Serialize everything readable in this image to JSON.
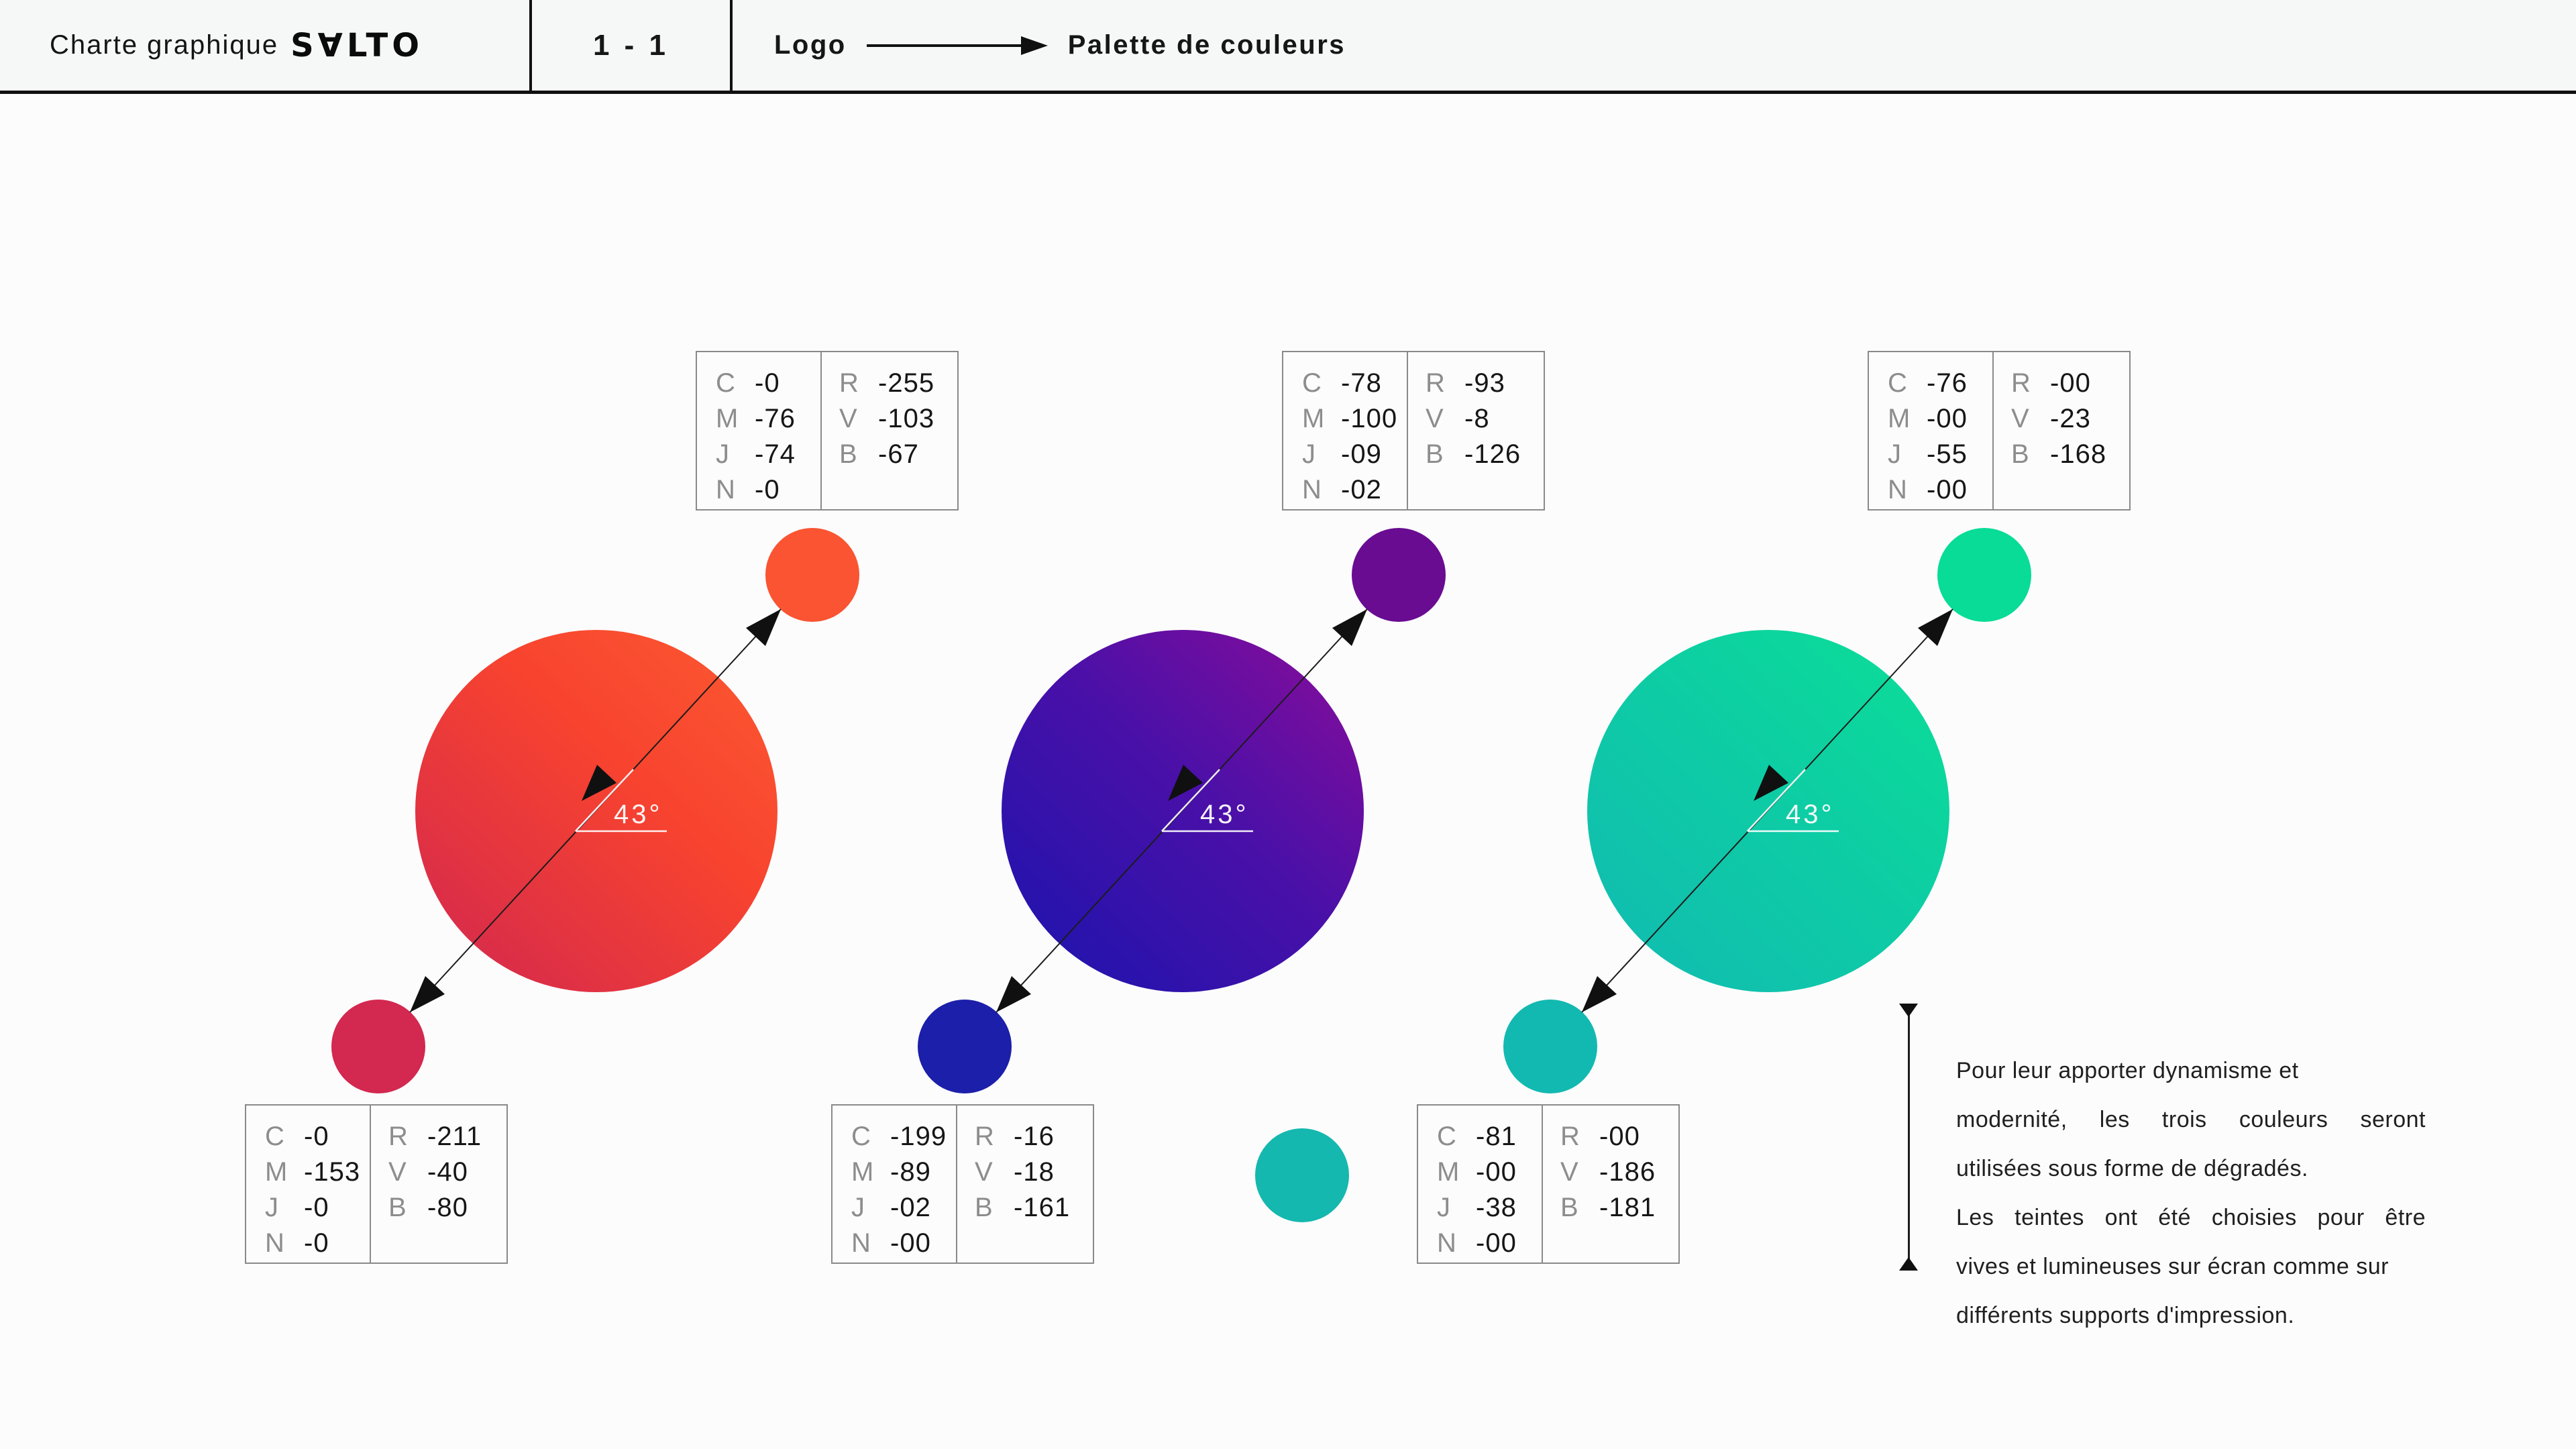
{
  "header": {
    "title_prefix": "Charte graphique",
    "brand": "S∀LTO",
    "page": "1 - 1",
    "section": "Logo",
    "subsection": "Palette de couleurs"
  },
  "angle_label": "43°",
  "groups": [
    {
      "name": "rouge-orange",
      "approx_hex": {
        "gradient_start": "#D12750",
        "gradient_end": "#FB5A31",
        "top_circle": "#FA5432",
        "bottom_circle": "#D32850"
      },
      "top": {
        "cmjn": [
          {
            "k": "C",
            "v": "-0"
          },
          {
            "k": "M",
            "v": "-76"
          },
          {
            "k": "J",
            "v": "-74"
          },
          {
            "k": "N",
            "v": "-0"
          }
        ],
        "rvb": [
          {
            "k": "R",
            "v": "-255"
          },
          {
            "k": "V",
            "v": "-103"
          },
          {
            "k": "B",
            "v": "-67"
          }
        ]
      },
      "bottom": {
        "cmjn": [
          {
            "k": "C",
            "v": "-0"
          },
          {
            "k": "M",
            "v": "-153"
          },
          {
            "k": "J",
            "v": "-0"
          },
          {
            "k": "N",
            "v": "-0"
          }
        ],
        "rvb": [
          {
            "k": "R",
            "v": "-211"
          },
          {
            "k": "V",
            "v": "-40"
          },
          {
            "k": "B",
            "v": "-80"
          }
        ]
      }
    },
    {
      "name": "bleu-violet",
      "approx_hex": {
        "gradient_start": "#1A14AE",
        "gradient_end": "#8C0C99",
        "top_circle": "#690C92",
        "bottom_circle": "#1B1FA9"
      },
      "top": {
        "cmjn": [
          {
            "k": "C",
            "v": "-78"
          },
          {
            "k": "M",
            "v": "-100"
          },
          {
            "k": "J",
            "v": "-09"
          },
          {
            "k": "N",
            "v": "-02"
          }
        ],
        "rvb": [
          {
            "k": "R",
            "v": "-93"
          },
          {
            "k": "V",
            "v": "-8"
          },
          {
            "k": "B",
            "v": "-126"
          }
        ]
      },
      "bottom": {
        "cmjn": [
          {
            "k": "C",
            "v": "-199"
          },
          {
            "k": "M",
            "v": "-89"
          },
          {
            "k": "J",
            "v": "-02"
          },
          {
            "k": "N",
            "v": "-00"
          }
        ],
        "rvb": [
          {
            "k": "R",
            "v": "-16"
          },
          {
            "k": "V",
            "v": "-18"
          },
          {
            "k": "B",
            "v": "-161"
          }
        ]
      }
    },
    {
      "name": "turquoise-vert",
      "approx_hex": {
        "gradient_start": "#12BAB2",
        "gradient_end": "#0CDF96",
        "top_circle": "#08DC96",
        "bottom_circle": "#12B9B1",
        "floating_dot": "#14B8AE"
      },
      "top": {
        "cmjn": [
          {
            "k": "C",
            "v": "-76"
          },
          {
            "k": "M",
            "v": "-00"
          },
          {
            "k": "J",
            "v": "-55"
          },
          {
            "k": "N",
            "v": "-00"
          }
        ],
        "rvb": [
          {
            "k": "R",
            "v": "-00"
          },
          {
            "k": "V",
            "v": "-23"
          },
          {
            "k": "B",
            "v": "-168"
          }
        ]
      },
      "bottom": {
        "cmjn": [
          {
            "k": "C",
            "v": "-81"
          },
          {
            "k": "M",
            "v": "-00"
          },
          {
            "k": "J",
            "v": "-38"
          },
          {
            "k": "N",
            "v": "-00"
          }
        ],
        "rvb": [
          {
            "k": "R",
            "v": "-00"
          },
          {
            "k": "V",
            "v": "-186"
          },
          {
            "k": "B",
            "v": "-181"
          }
        ]
      }
    }
  ],
  "note": {
    "lines": [
      "Pour leur apporter dynamisme et",
      "modernité, les trois couleurs seront",
      "utilisées sous forme de dégradés.",
      "Les teintes ont été choisies pour être",
      "vives et lumineuses sur écran comme sur",
      "différents supports d'impression."
    ]
  }
}
